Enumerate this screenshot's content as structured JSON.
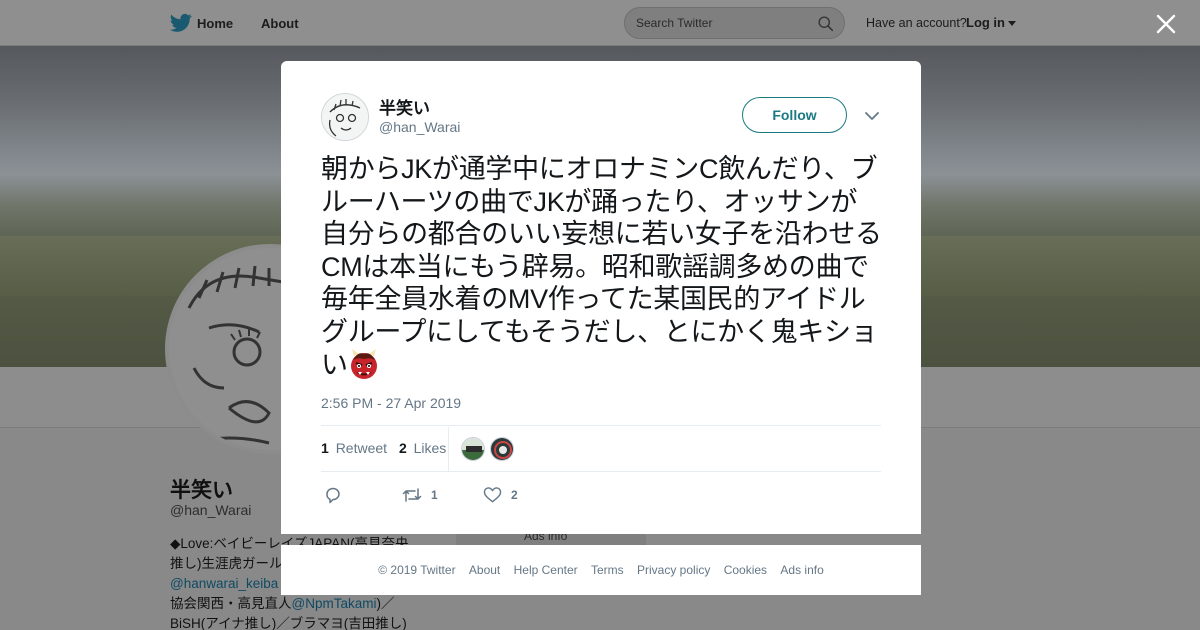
{
  "nav": {
    "home_label": "Home",
    "about_label": "About",
    "search_placeholder": "Search Twitter",
    "have_account": "Have an account?",
    "login_label": "Log in"
  },
  "profile_bg": {
    "name": "半笑い",
    "handle": "@han_Warai",
    "bio_lines": [
      {
        "text": "◆Love:ベイビーレイズJAPAN(高見奈央",
        "link": ""
      },
      {
        "text": "推し)生涯虎ガール／",
        "link": ""
      },
      {
        "text": "",
        "link": "@hanwarai_keiba"
      },
      {
        "text": "協会関西・高見直人",
        "link": "@NpmTakami",
        "tail": ")／"
      },
      {
        "text": "BiSH(アイナ推し)／ブラマヨ(吉田推し)",
        "link": ""
      }
    ],
    "ads_info": "Ads info"
  },
  "tweet": {
    "author_name": "半笑い",
    "author_handle": "@han_Warai",
    "follow_label": "Follow",
    "text": "朝からJKが通学中にオロナミンC飲んだり、ブルーハーツの曲でJKが踊ったり、オッサンが自分らの都合のいい妄想に若い女子を沿わせるCMは本当にもう辟易。昭和歌謡調多めの曲で毎年全員水着のMV作ってた某国民的アイドルグループにしてもそうだし、とにかく鬼キショい",
    "emoji_icon": "japanese-ogre-icon",
    "timestamp": "2:56 PM - 27 Apr 2019",
    "retweet_count": "1",
    "retweet_label": "Retweet",
    "likes_count": "2",
    "likes_label": "Likes",
    "action_retweet_count": "1",
    "action_like_count": "2"
  },
  "footer": {
    "links": [
      "© 2019 Twitter",
      "About",
      "Help Center",
      "Terms",
      "Privacy policy",
      "Cookies",
      "Ads info"
    ]
  },
  "colors": {
    "follow_accent": "#1b7a82",
    "muted_text": "#657786",
    "overlay": "#8c8c8c"
  }
}
